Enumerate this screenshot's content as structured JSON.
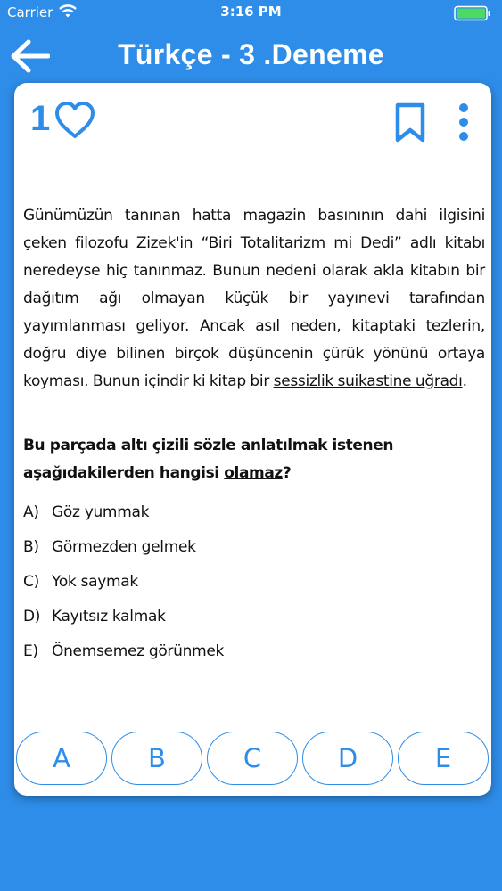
{
  "status_bar": {
    "carrier": "Carrier",
    "time": "3:16 PM"
  },
  "nav": {
    "title": "Türkçe - 3 .Deneme"
  },
  "card": {
    "like_count": "1"
  },
  "passage": {
    "part1": "Günümüzün tanınan hatta magazin basınının dahi ilgisini çeken filozofu Zizek'in “Biri Totalitarizm mi Dedi” adlı kitabı neredeyse hiç tanınmaz. Bunun nedeni olarak akla kitabın bir dağıtım ağı olmayan küçük bir yayınevi tarafından yayımlanması geliyor. Ancak asıl neden, kitaptaki tezlerin, doğru diye bilinen birçok düşüncenin çürük yönünü ortaya koyması. Bunun içindir ki kitap bir ",
    "underlined": "sessizlik suikastine uğradı",
    "part2": "."
  },
  "question": {
    "part1": "Bu parçada altı çizili sözle anlatılmak istenen aşağıdakilerden hangisi ",
    "underlined": "olamaz",
    "part2": "?"
  },
  "options": [
    {
      "letter": "A)",
      "text": "Göz yummak"
    },
    {
      "letter": "B)",
      "text": "Görmezden gelmek"
    },
    {
      "letter": "C)",
      "text": "Yok saymak"
    },
    {
      "letter": "D)",
      "text": "Kayıtsız kalmak"
    },
    {
      "letter": "E)",
      "text": "Önemsemez görünmek"
    }
  ],
  "answers": [
    "A",
    "B",
    "C",
    "D",
    "E"
  ],
  "colors": {
    "accent": "#2e8de8",
    "background": "#2e8de8",
    "card": "#ffffff"
  },
  "icons": [
    "wifi-icon",
    "battery-icon",
    "back-arrow-icon",
    "heart-icon",
    "bookmark-icon",
    "more-vertical-icon"
  ]
}
